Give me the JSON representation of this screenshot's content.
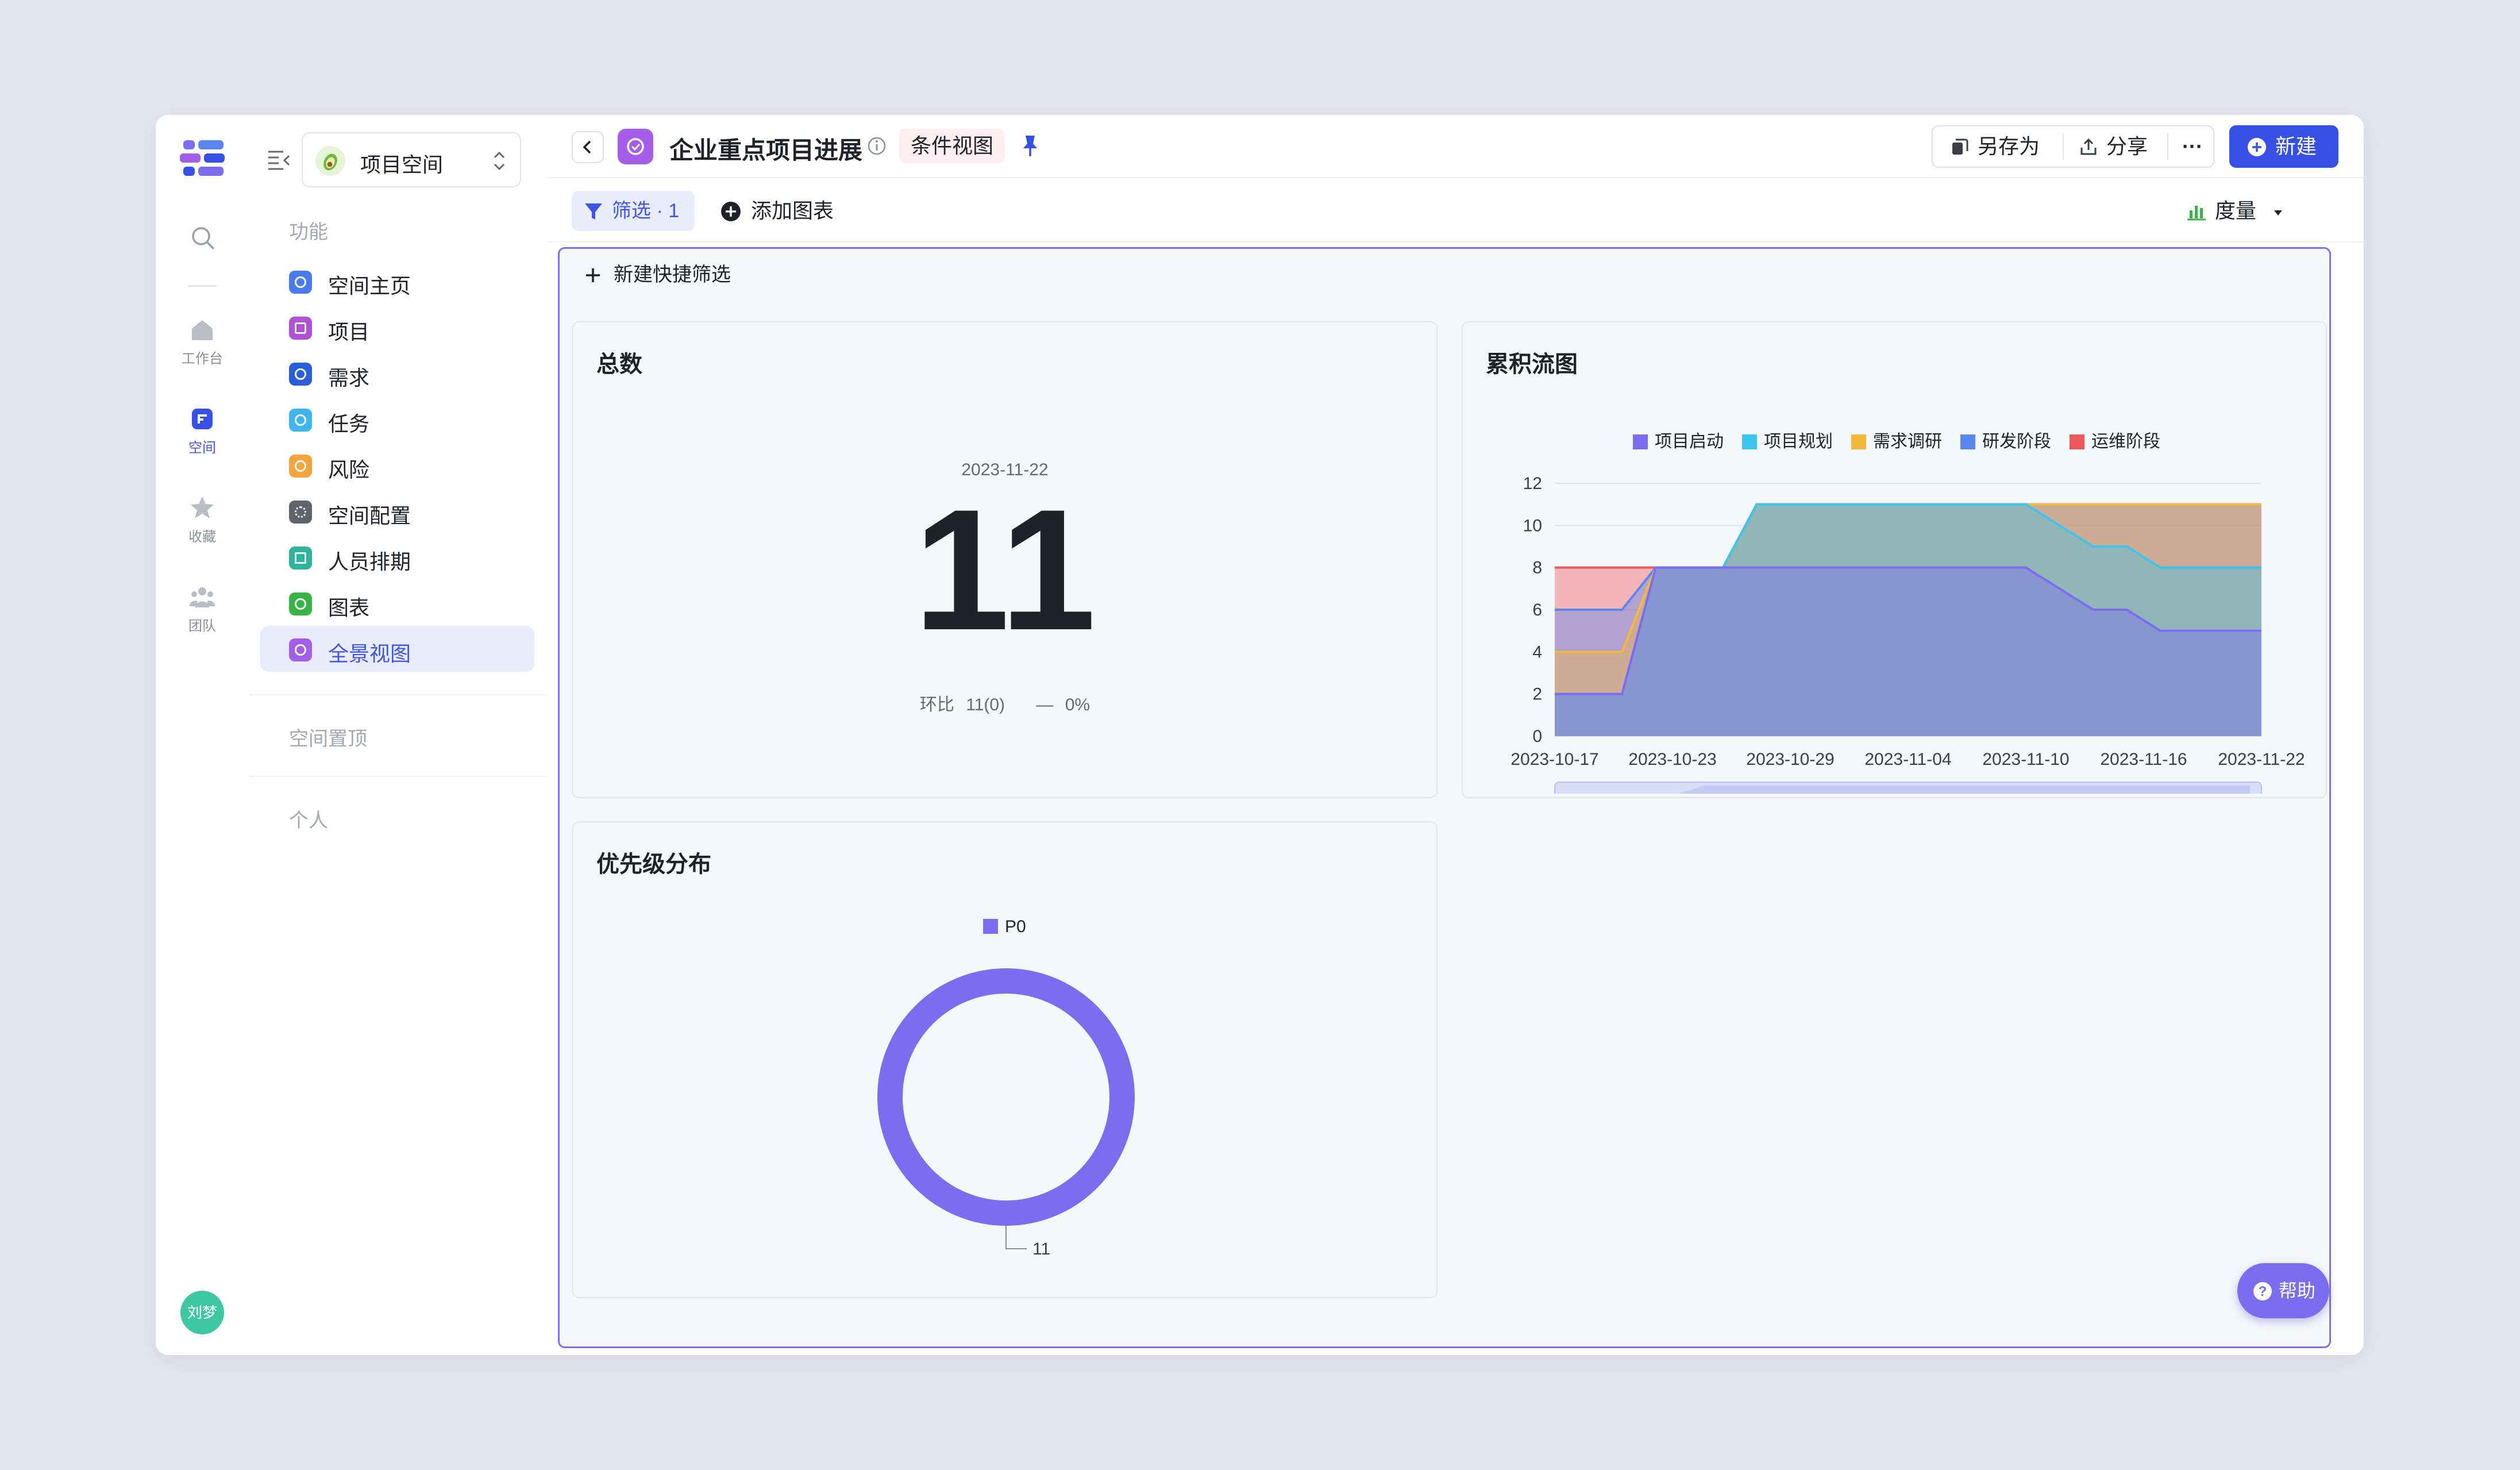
{
  "rail": {
    "items": [
      {
        "label": "工作台",
        "icon": "home-icon"
      },
      {
        "label": "空间",
        "icon": "space-icon"
      },
      {
        "label": "收藏",
        "icon": "star-icon"
      },
      {
        "label": "团队",
        "icon": "team-icon"
      }
    ],
    "avatar_text": "刘梦"
  },
  "sidebar": {
    "space_name": "项目空间",
    "section_function": "功能",
    "items": [
      {
        "label": "空间主页",
        "color": "#4a7cf0"
      },
      {
        "label": "项目",
        "color": "#b14fd6"
      },
      {
        "label": "需求",
        "color": "#2a5fd9"
      },
      {
        "label": "任务",
        "color": "#3fb5ef"
      },
      {
        "label": "风险",
        "color": "#f5a33a"
      },
      {
        "label": "空间配置",
        "color": "#5f636b"
      },
      {
        "label": "人员排期",
        "color": "#2bb59a"
      },
      {
        "label": "图表",
        "color": "#36b546"
      },
      {
        "label": "全景视图",
        "color": "#a45ee8"
      }
    ],
    "section_pinned": "空间置顶",
    "section_personal": "个人"
  },
  "topbar": {
    "title": "企业重点项目进展",
    "view_tag": "条件视图",
    "save_as": "另存为",
    "share": "分享",
    "more": "···",
    "new_label": "新建"
  },
  "toolbar": {
    "filter_label": "筛选 · 1",
    "add_chart": "添加图表",
    "measure": "度量"
  },
  "canvas": {
    "quick_filter": "新建快捷筛选",
    "help": "帮助"
  },
  "total_card": {
    "title": "总数",
    "date": "2023-11-22",
    "value": "11",
    "compare_label": "环比",
    "compare_value": "11(0)",
    "compare_delta": "0%"
  },
  "chart_data": [
    {
      "type": "area",
      "title": "累积流图",
      "stacked": true,
      "x": [
        "2023-10-17",
        "2023-10-23",
        "2023-10-29",
        "2023-11-04",
        "2023-11-10",
        "2023-11-16",
        "2023-11-22"
      ],
      "ylim": [
        0,
        12
      ],
      "yticks": [
        0,
        2,
        4,
        6,
        8,
        10,
        12
      ],
      "legend_position": "top",
      "series": [
        {
          "name": "项目启动",
          "color": "#7b6cf0"
        },
        {
          "name": "项目规划",
          "color": "#3ec5ef"
        },
        {
          "name": "需求调研",
          "color": "#f2b93b"
        },
        {
          "name": "研发阶段",
          "color": "#5b86f2"
        },
        {
          "name": "运维阶段",
          "color": "#ee5a5a"
        }
      ],
      "stacked_top_values": {
        "项目启动": [
          2,
          2,
          2,
          8,
          8,
          8,
          8,
          8,
          8,
          8,
          8,
          8,
          8,
          8,
          8,
          7,
          6,
          6,
          5,
          5,
          5,
          5
        ],
        "项目规划": [
          2,
          2,
          2,
          8,
          8,
          8,
          11,
          11,
          11,
          11,
          11,
          11,
          11,
          11,
          11,
          10,
          9,
          9,
          8,
          8,
          8,
          8
        ],
        "需求调研": [
          4,
          4,
          4,
          8,
          8,
          8,
          11,
          11,
          11,
          11,
          11,
          11,
          11,
          11,
          11,
          11,
          11,
          11,
          11,
          11,
          11,
          11
        ],
        "研发阶段": [
          6,
          6,
          6,
          8,
          8,
          8,
          11,
          11,
          11,
          11,
          11,
          11,
          11,
          11,
          11,
          11,
          11,
          11,
          11,
          11,
          11,
          11
        ],
        "运维阶段": [
          8,
          8,
          8,
          8,
          8,
          8,
          11,
          11,
          11,
          11,
          11,
          11,
          11,
          11,
          11,
          11,
          11,
          11,
          11,
          11,
          11,
          11
        ]
      }
    },
    {
      "type": "pie",
      "title": "优先级分布",
      "donut": true,
      "legend_position": "top",
      "slices": [
        {
          "name": "P0",
          "value": 11,
          "color": "#7b6cf0"
        }
      ]
    }
  ]
}
